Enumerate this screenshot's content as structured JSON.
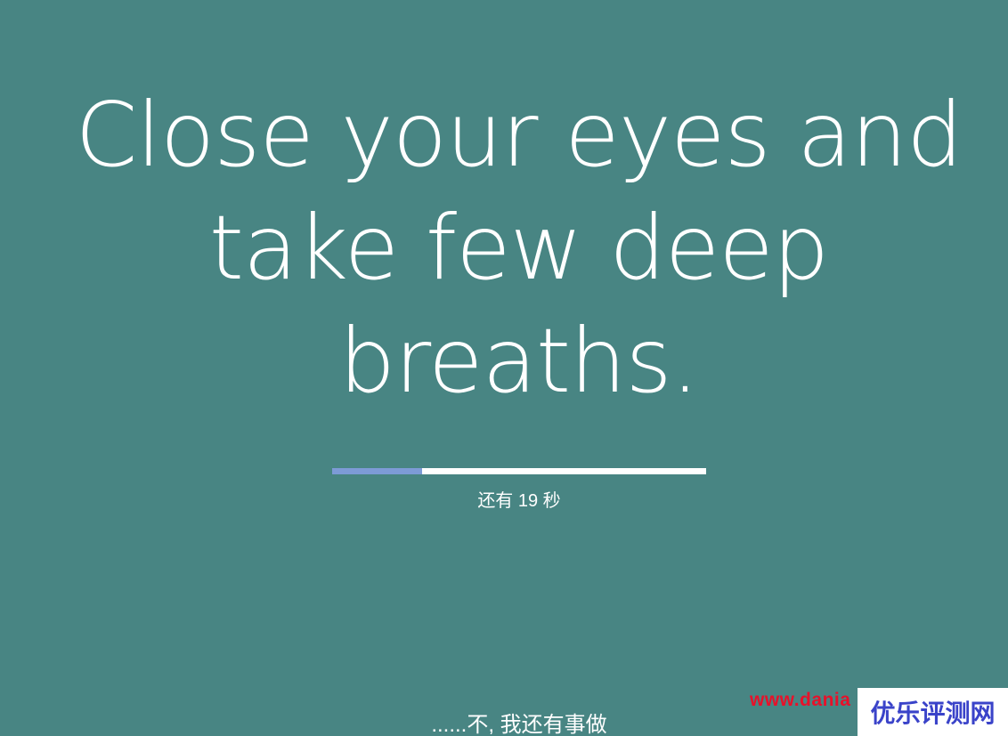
{
  "message": {
    "line1": "Close your eyes and",
    "line2": "take few deep",
    "line3": "breaths."
  },
  "progress": {
    "elapsed_fraction": 0.24
  },
  "countdown": {
    "text": "还有 19 秒"
  },
  "skip": {
    "label": "......不, 我还有事做"
  },
  "watermark": {
    "url": "www.dania",
    "badge": "优乐评测网"
  },
  "colors": {
    "background": "#488583",
    "text": "#ffffff",
    "progress_fill": "#7d9bd6",
    "progress_track": "#ffffff",
    "watermark_url": "#e8112a",
    "watermark_badge": "#3a43c9"
  }
}
